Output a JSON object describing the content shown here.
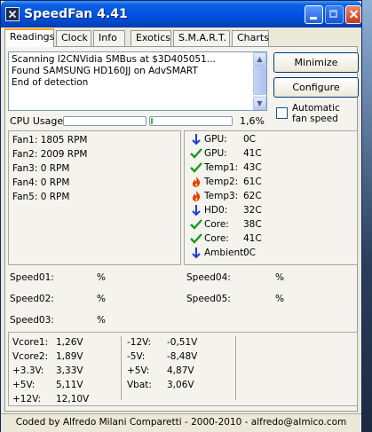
{
  "window": {
    "title": "SpeedFan 4.41"
  },
  "tabs": [
    {
      "label": "Readings",
      "active": true
    },
    {
      "label": "Clock",
      "active": false
    },
    {
      "label": "Info",
      "active": false
    },
    {
      "label": "Exotics",
      "active": false
    },
    {
      "label": "S.M.A.R.T.",
      "active": false
    },
    {
      "label": "Charts",
      "active": false
    }
  ],
  "log": {
    "lines": [
      "Scanning I2CNVidia SMBus at $3D405051...",
      "Found SAMSUNG HD160JJ on AdvSMART",
      "End of detection"
    ]
  },
  "buttons": {
    "minimize": "Minimize",
    "configure": "Configure"
  },
  "auto_fan": {
    "label": "Automatic fan speed",
    "checked": false
  },
  "cpu": {
    "label": "CPU Usage",
    "percent_text": "1,6%",
    "bar1_fraction": 0.0,
    "bar2_fraction": 0.02
  },
  "fans": [
    {
      "text": "Fan1: 1805 RPM"
    },
    {
      "text": "Fan2: 2009 RPM"
    },
    {
      "text": "Fan3: 0 RPM"
    },
    {
      "text": "Fan4: 0 RPM"
    },
    {
      "text": "Fan5: 0 RPM"
    }
  ],
  "temps": [
    {
      "label": "GPU:",
      "value": "0C",
      "icon": "arrow-down-icon"
    },
    {
      "label": "GPU:",
      "value": "41C",
      "icon": "checkmark-icon"
    },
    {
      "label": "Temp1:",
      "value": "43C",
      "icon": "checkmark-icon"
    },
    {
      "label": "Temp2:",
      "value": "61C",
      "icon": "flame-icon"
    },
    {
      "label": "Temp3:",
      "value": "62C",
      "icon": "flame-icon"
    },
    {
      "label": "HD0:",
      "value": "32C",
      "icon": "arrow-down-icon"
    },
    {
      "label": "Core:",
      "value": "38C",
      "icon": "checkmark-icon"
    },
    {
      "label": "Core:",
      "value": "41C",
      "icon": "checkmark-icon"
    },
    {
      "label": "Ambient:",
      "value": "0C",
      "icon": "arrow-down-icon"
    }
  ],
  "speeds": [
    {
      "label": "Speed01:",
      "value": "%"
    },
    {
      "label": "Speed02:",
      "value": "%"
    },
    {
      "label": "Speed03:",
      "value": "%"
    },
    {
      "label": "Speed04:",
      "value": "%"
    },
    {
      "label": "Speed05:",
      "value": "%"
    }
  ],
  "voltages_left": [
    {
      "label": "Vcore1:",
      "value": "1,26V"
    },
    {
      "label": "Vcore2:",
      "value": "1,89V"
    },
    {
      "label": "+3.3V:",
      "value": "3,33V"
    },
    {
      "label": "+5V:",
      "value": "5,11V"
    },
    {
      "label": "+12V:",
      "value": "12,10V"
    }
  ],
  "voltages_right": [
    {
      "label": "-12V:",
      "value": "-0,51V"
    },
    {
      "label": "-5V:",
      "value": "-8,48V"
    },
    {
      "label": "+5V:",
      "value": "4,87V"
    },
    {
      "label": "Vbat:",
      "value": "3,06V"
    }
  ],
  "status": {
    "text": "Coded by Alfredo Milani Comparetti - 2000-2010 - alfredo@almico.com"
  },
  "colors": {
    "ok": "#1a9a1a",
    "hot": "#e23a0a",
    "low": "#1a3fd0",
    "bar": "#3dbd3d"
  }
}
